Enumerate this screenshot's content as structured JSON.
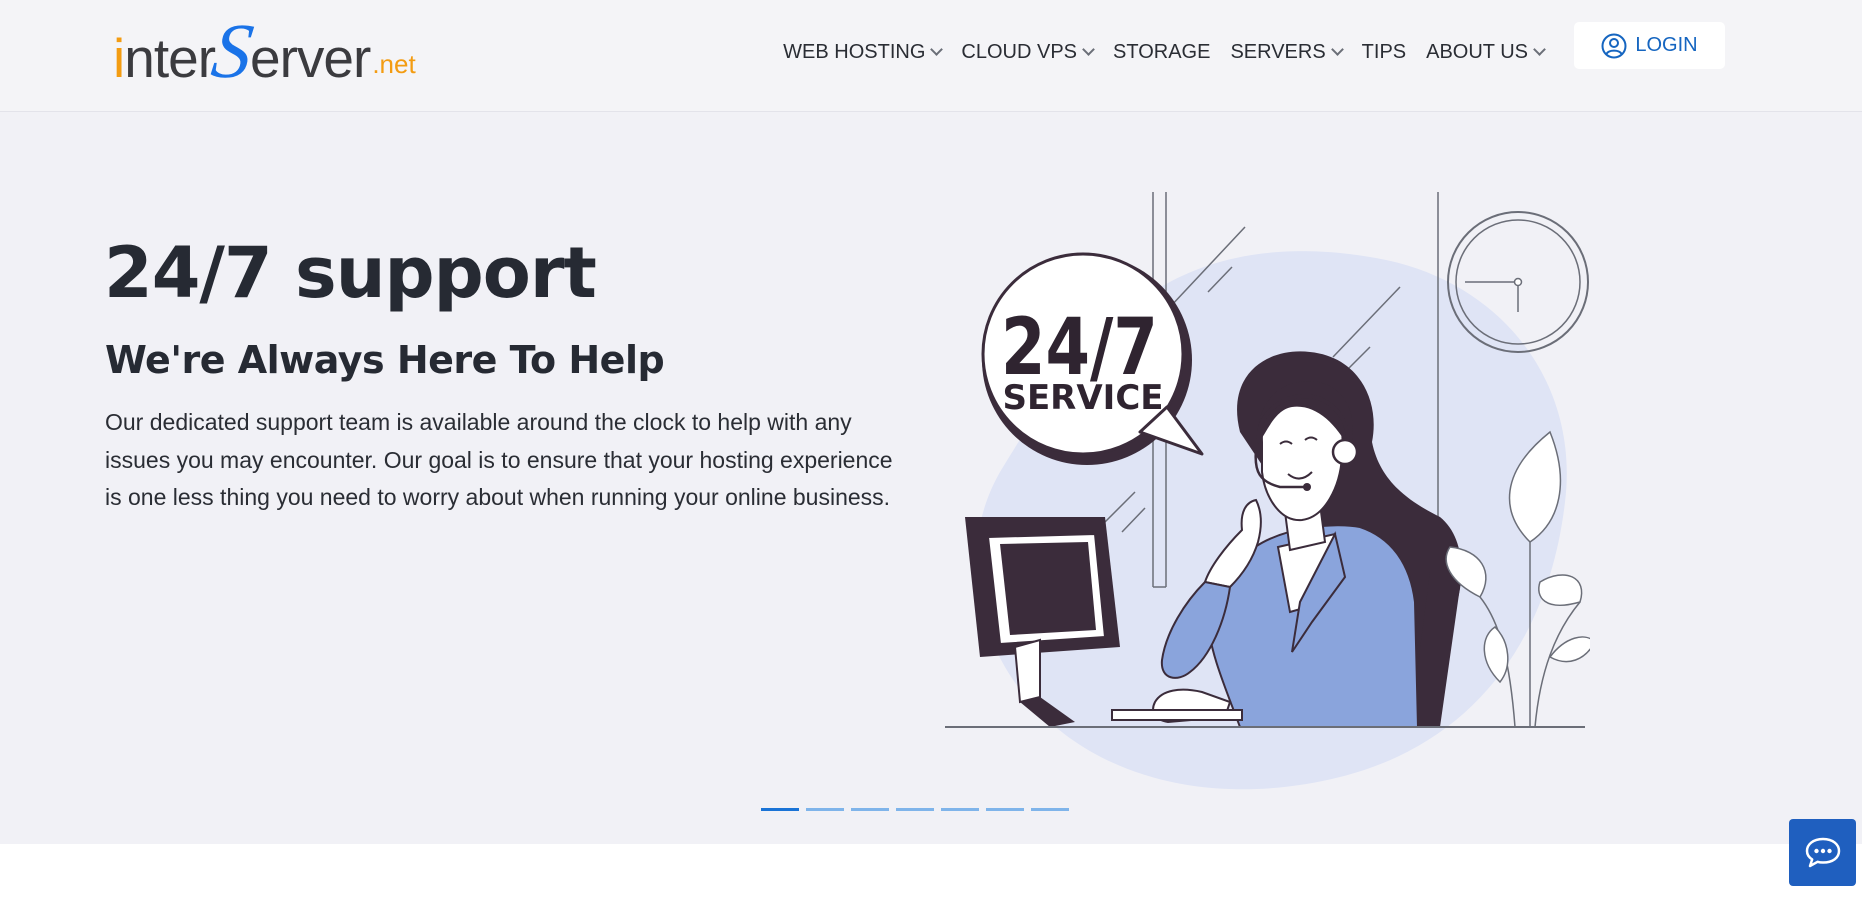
{
  "logo": {
    "brand_i": "i",
    "brand_nter": "nter",
    "brand_s": "S",
    "brand_erver": "erver",
    "brand_net": ".net"
  },
  "nav": {
    "items": [
      {
        "label": "WEB HOSTING",
        "dropdown": true
      },
      {
        "label": "CLOUD VPS",
        "dropdown": true
      },
      {
        "label": "STORAGE",
        "dropdown": false
      },
      {
        "label": "SERVERS",
        "dropdown": true
      },
      {
        "label": "TIPS",
        "dropdown": false
      },
      {
        "label": "ABOUT US",
        "dropdown": true
      }
    ],
    "login_label": "LOGIN"
  },
  "hero": {
    "title": "24/7 support",
    "subtitle": "We're Always Here To Help",
    "text": "Our dedicated support team is available around the clock to help with any issues you may encounter. Our goal is to ensure that your hosting experience is one less thing you need to worry about when running your online business.",
    "badge_top": "24/7",
    "badge_bottom": "SERVICE"
  },
  "carousel": {
    "slide_count": 7,
    "active_index": 0
  },
  "colors": {
    "accent": "#1a73e8",
    "brand_orange": "#f39c12",
    "hero_bg": "#f1f1f6",
    "chat_bg": "#1f5fbf"
  },
  "icons": {
    "login": "user-circle-icon",
    "chat": "chat-bubble-icon",
    "dropdown": "chevron-down-icon"
  }
}
